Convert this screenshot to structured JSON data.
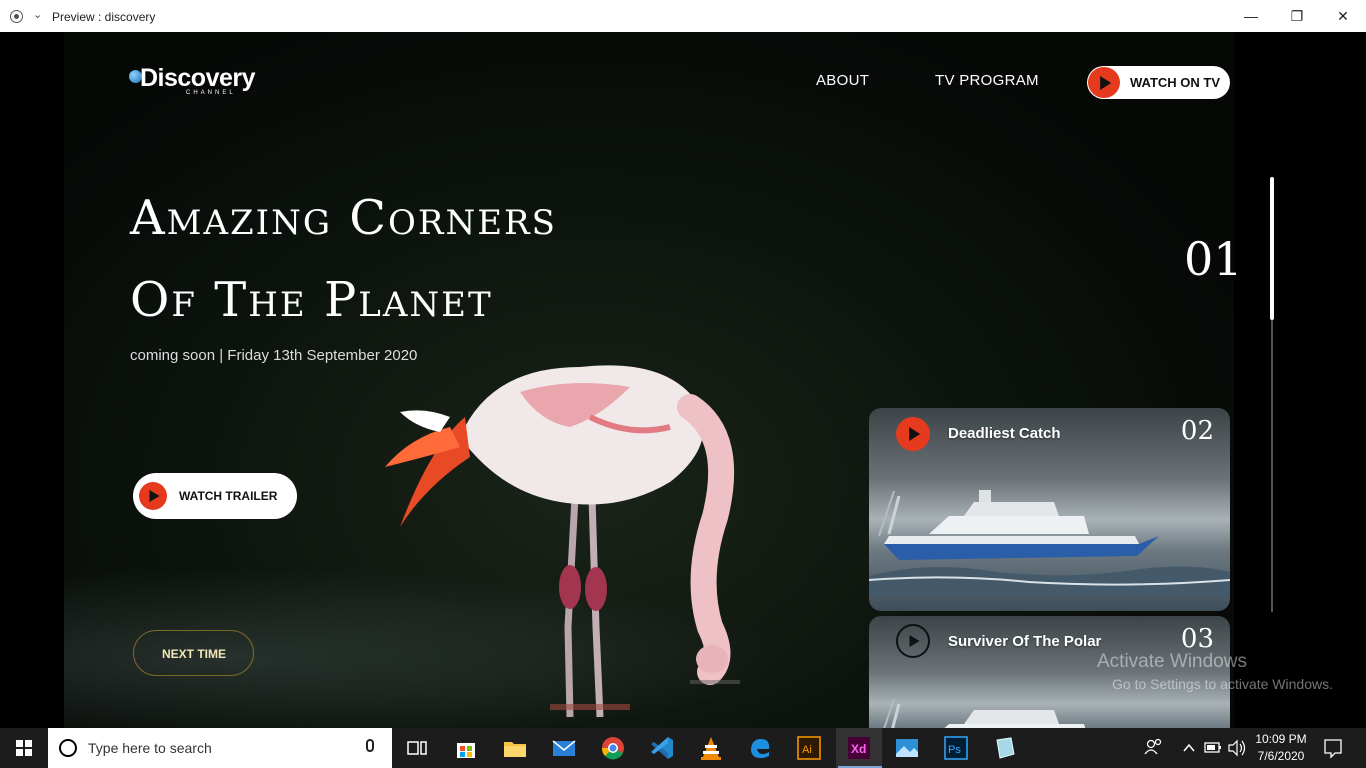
{
  "window": {
    "title": "Preview : discovery"
  },
  "logo": {
    "brand": "Discovery",
    "sub": "CHANNEL"
  },
  "nav": {
    "about": "ABOUT",
    "tv_program": "TV PROGRAM",
    "watch_on_tv": "WATCH ON TV"
  },
  "hero": {
    "title_line1": "Amazing Corners",
    "title_line2": "Of The Planet",
    "subtitle": "coming soon | Friday 13th September 2020",
    "watch_trailer": "WATCH TRAILER",
    "next_time": "NEXT TIME",
    "slide_number": "01"
  },
  "cards": [
    {
      "title": "Deadliest Catch",
      "number": "02"
    },
    {
      "title": "Surviver Of The Polar",
      "number": "03"
    }
  ],
  "watermark": {
    "line1": "Activate Windows",
    "line2": "Go to Settings to activate Windows."
  },
  "taskbar": {
    "search_placeholder": "Type here to search",
    "time": "10:09 PM",
    "date": "7/6/2020"
  },
  "colors": {
    "accent_red": "#e63a1e",
    "background": "#000000",
    "next_border": "#7a6a2a"
  }
}
